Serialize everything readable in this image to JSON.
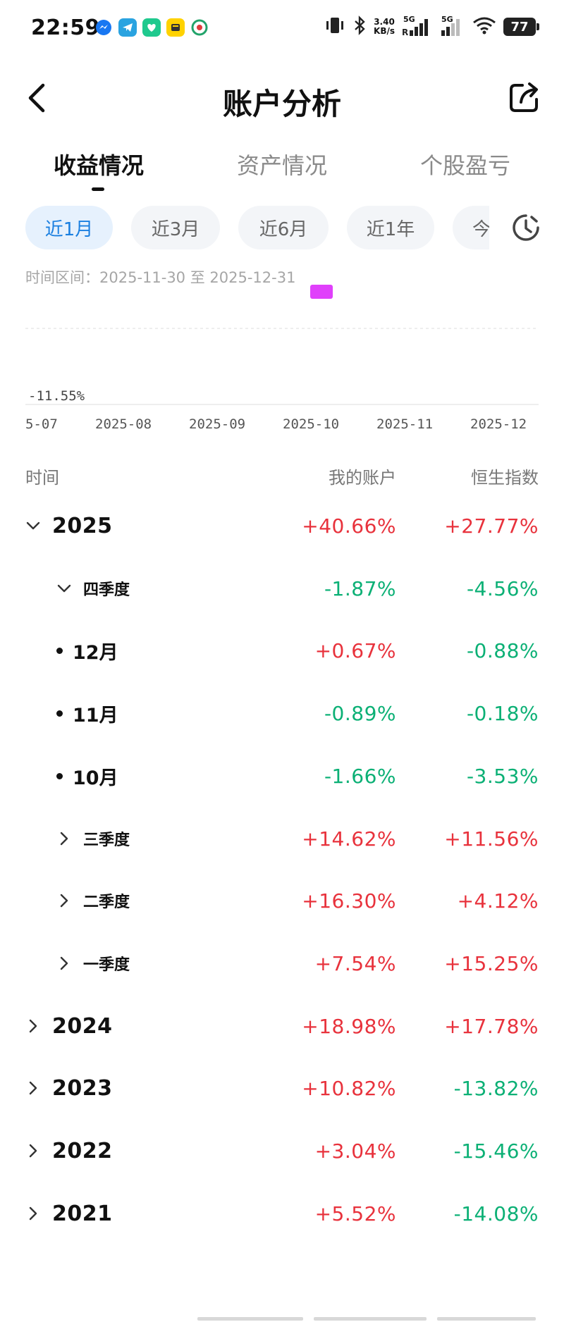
{
  "status_bar": {
    "time": "22:59",
    "net_speed_value": "3.40",
    "net_speed_unit": "KB/s",
    "signal_1_label": "5G",
    "signal_2_label": "5G",
    "battery": "77",
    "icons": [
      "messenger-icon",
      "telegram-icon",
      "heart-app-icon",
      "notes-app-icon",
      "china-mobile-icon",
      "vibrate-icon",
      "bluetooth-icon",
      "signal-icon",
      "wifi-icon",
      "battery-icon"
    ]
  },
  "header": {
    "title": "账户分析"
  },
  "main_tabs": [
    {
      "label": "收益情况",
      "active": true
    },
    {
      "label": "资产情况",
      "active": false
    },
    {
      "label": "个股盈亏",
      "active": false
    }
  ],
  "periods": [
    {
      "label": "近1月",
      "active": true
    },
    {
      "label": "近3月",
      "active": false
    },
    {
      "label": "近6月",
      "active": false
    },
    {
      "label": "近1年",
      "active": false
    },
    {
      "label": "今",
      "active": false
    }
  ],
  "range": {
    "label": "时间区间：2025-11-30 至 2025-12-31"
  },
  "chart_data": {
    "type": "line",
    "min_label": "-11.55%",
    "x_tick_labels": [
      "5-07",
      "2025-08",
      "2025-09",
      "2025-10",
      "2025-11",
      "2025-12"
    ],
    "series_color": "#e040fb"
  },
  "table": {
    "headers": {
      "time": "时间",
      "mine": "我的账户",
      "hsi": "恒生指数"
    },
    "rows": [
      {
        "level": "year",
        "label": "2025",
        "expanded": true,
        "mine": "+40.66%",
        "hsi": "+27.77%"
      },
      {
        "level": "quarter",
        "label": "四季度",
        "expanded": true,
        "mine": "-1.87%",
        "hsi": "-4.56%"
      },
      {
        "level": "month",
        "label": "12月",
        "mine": "+0.67%",
        "hsi": "-0.88%"
      },
      {
        "level": "month",
        "label": "11月",
        "mine": "-0.89%",
        "hsi": "-0.18%"
      },
      {
        "level": "month",
        "label": "10月",
        "mine": "-1.66%",
        "hsi": "-3.53%"
      },
      {
        "level": "quarter",
        "label": "三季度",
        "expanded": false,
        "mine": "+14.62%",
        "hsi": "+11.56%"
      },
      {
        "level": "quarter",
        "label": "二季度",
        "expanded": false,
        "mine": "+16.30%",
        "hsi": "+4.12%"
      },
      {
        "level": "quarter",
        "label": "一季度",
        "expanded": false,
        "mine": "+7.54%",
        "hsi": "+15.25%"
      },
      {
        "level": "year",
        "label": "2024",
        "expanded": false,
        "mine": "+18.98%",
        "hsi": "+17.78%"
      },
      {
        "level": "year",
        "label": "2023",
        "expanded": false,
        "mine": "+10.82%",
        "hsi": "-13.82%"
      },
      {
        "level": "year",
        "label": "2022",
        "expanded": false,
        "mine": "+3.04%",
        "hsi": "-15.46%"
      },
      {
        "level": "year",
        "label": "2021",
        "expanded": false,
        "mine": "+5.52%",
        "hsi": "-14.08%"
      }
    ]
  },
  "colors": {
    "positive": "#e8323c",
    "negative": "#0bb075",
    "accent": "#1a7fe0"
  }
}
